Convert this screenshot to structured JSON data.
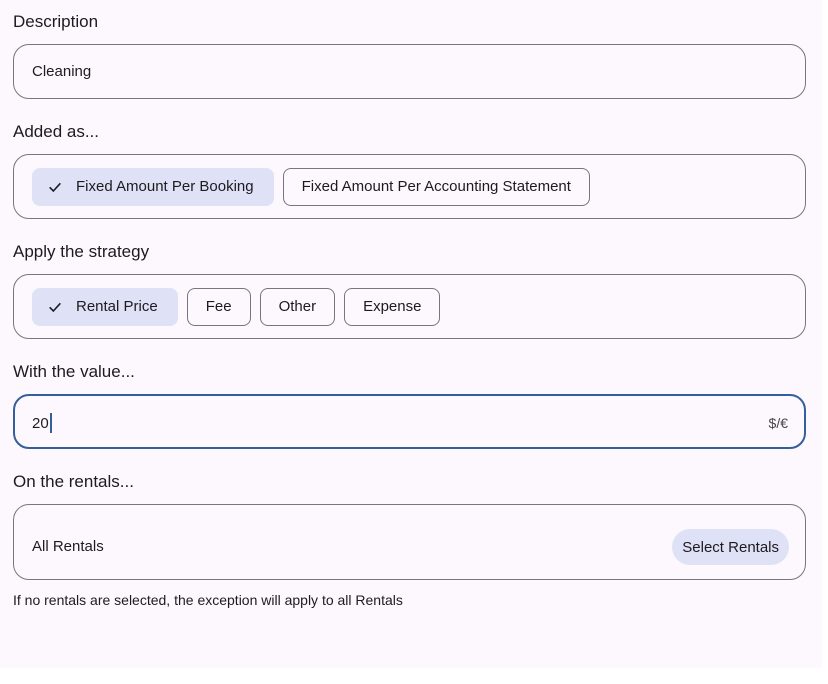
{
  "description": {
    "label": "Description",
    "value": "Cleaning"
  },
  "added_as": {
    "label": "Added as...",
    "options": [
      {
        "label": "Fixed Amount Per Booking",
        "selected": true
      },
      {
        "label": "Fixed Amount Per Accounting Statement",
        "selected": false
      }
    ]
  },
  "strategy": {
    "label": "Apply the strategy",
    "options": [
      {
        "label": "Rental Price",
        "selected": true
      },
      {
        "label": "Fee",
        "selected": false
      },
      {
        "label": "Other",
        "selected": false
      },
      {
        "label": "Expense",
        "selected": false
      }
    ]
  },
  "value_field": {
    "label": "With the value...",
    "value": "20",
    "suffix": "$/€"
  },
  "rentals": {
    "label": "On the rentals...",
    "value": "All Rentals",
    "select_button": "Select Rentals",
    "helper": "If no rentals are selected, the exception will apply to all Rentals"
  },
  "colors": {
    "background": "#fdf8fd",
    "outline": "#79747e",
    "focus": "#355f9b",
    "chip_selected": "#dfe2f6"
  },
  "icons": {
    "chip_selected": "check-icon"
  }
}
